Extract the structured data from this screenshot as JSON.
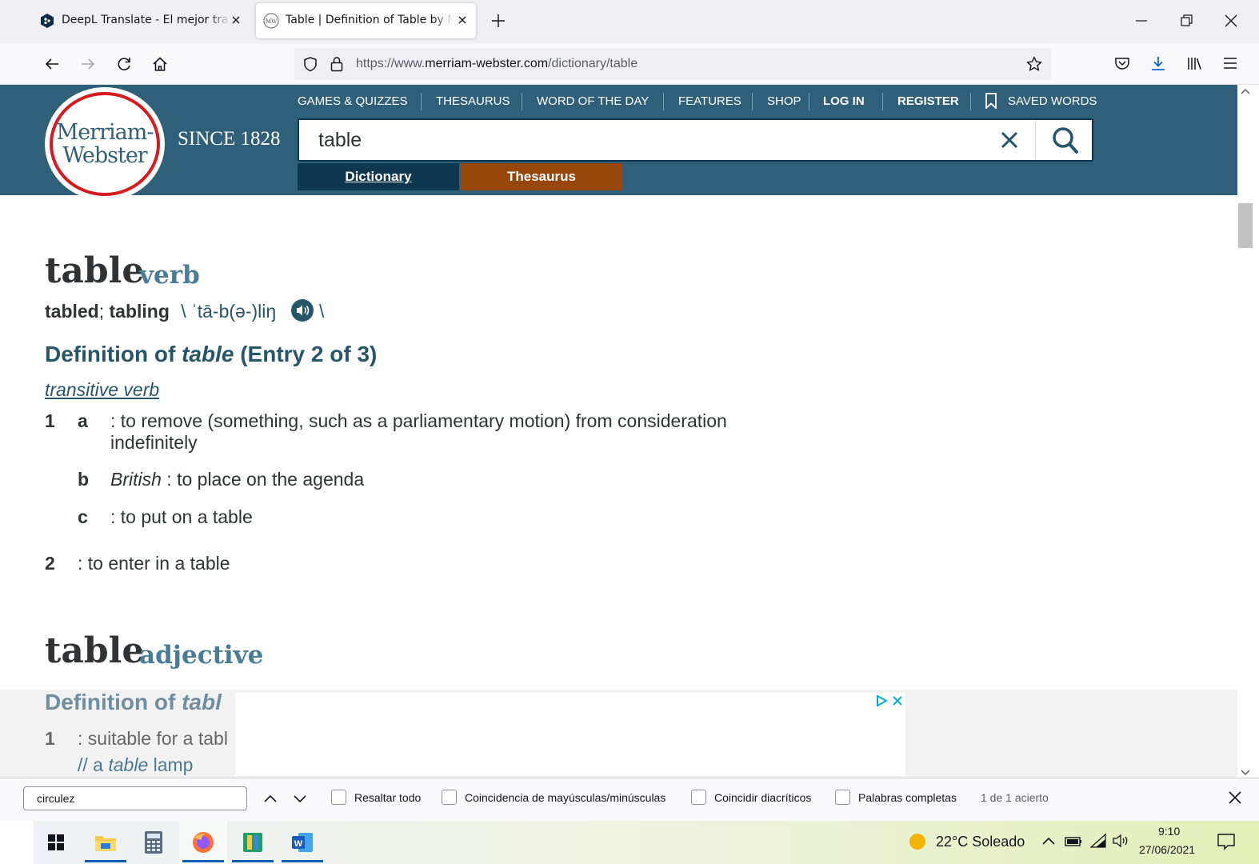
{
  "browser": {
    "tabs": [
      {
        "title": "DeepL Translate - El mejor traductor del mundo",
        "active": false,
        "icon": "deepl-icon"
      },
      {
        "title": "Table | Definition of Table by Merriam-Webster",
        "active": true,
        "icon": "merriam-webster-icon"
      }
    ],
    "url_prefix": "https://www.",
    "url_domain": "merriam-webster.com",
    "url_path": "/dictionary/table"
  },
  "site": {
    "logo_line1": "Merriam-",
    "logo_line2": "Webster",
    "since": "SINCE 1828",
    "nav": [
      "GAMES & QUIZZES",
      "THESAURUS",
      "WORD OF THE DAY",
      "FEATURES",
      "SHOP",
      "LOG IN",
      "REGISTER",
      "SAVED WORDS"
    ],
    "search_value": "table",
    "tab_dictionary": "Dictionary",
    "tab_thesaurus": "Thesaurus",
    "colors": {
      "header": "#305f7a",
      "dark": "#0f3850",
      "thesaurus": "#97460b",
      "logo_ring": "#d71920"
    }
  },
  "entry2": {
    "headword": "table",
    "pos": "verb",
    "inflection1": "tabled",
    "inflection_sep": ";",
    "inflection2": "tabling",
    "pron_open": "\\",
    "pron": "ˈtā-b(ə-)liŋ",
    "pron_close": "\\",
    "def_title_prefix": "Definition of ",
    "def_title_word": "table",
    "def_title_suffix": " (Entry 2 of 3)",
    "verb_type": "transitive verb",
    "senses": [
      {
        "num": "1",
        "letter": "a",
        "text": ": to remove (something, such as a parliamentary motion) from consideration",
        "text2": "indefinitely"
      },
      {
        "letter": "b",
        "label": "British",
        "text": ": to place on the agenda"
      },
      {
        "letter": "c",
        "text": ": to put on a table"
      },
      {
        "num": "2",
        "text": ": to enter in a table"
      }
    ]
  },
  "entry3": {
    "headword": "table",
    "pos": "adjective",
    "def_title_prefix": "Definition of ",
    "def_title_word": "tabl",
    "sense1_num": "1",
    "sense1_text": ": suitable for a tabl",
    "example_prefix": "// a ",
    "example_word": "table",
    "example_suffix": " lamp"
  },
  "findbar": {
    "query": "circulez",
    "options": [
      "Resaltar todo",
      "Coincidencia de mayúsculas/minúsculas",
      "Coincidir diacríticos",
      "Palabras completas"
    ],
    "result": "1 de 1 acierto"
  },
  "taskbar": {
    "weather": "22°C  Soleado",
    "time": "9:10",
    "date": "27/06/2021"
  }
}
